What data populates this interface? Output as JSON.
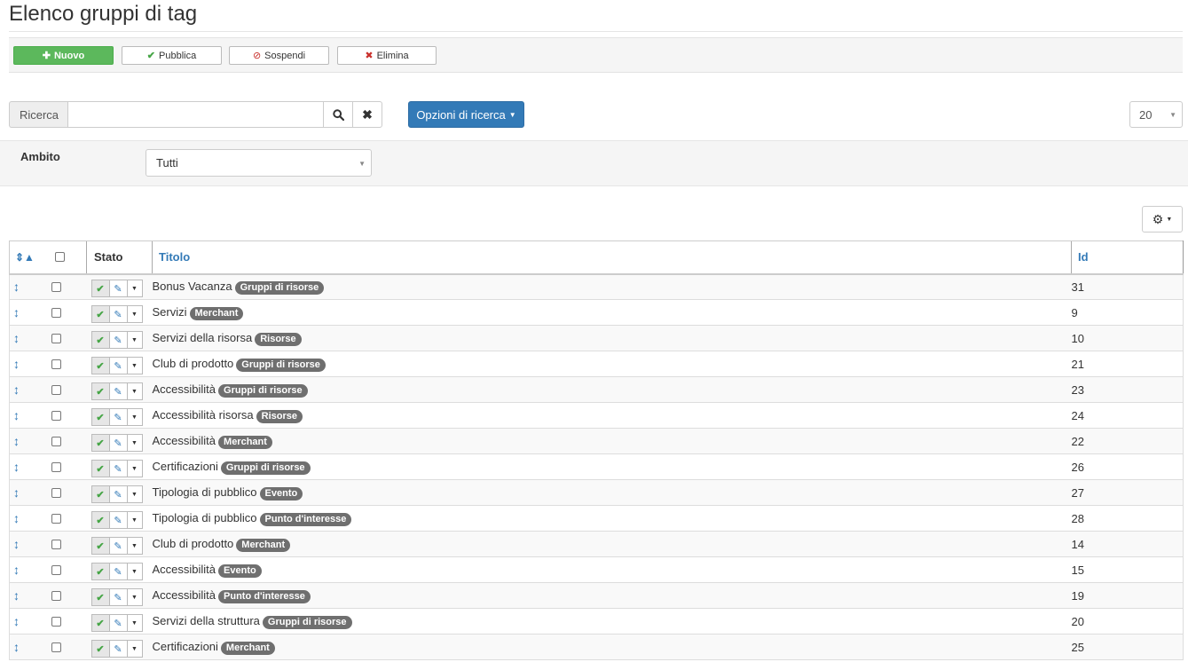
{
  "page": {
    "title": "Elenco gruppi di tag"
  },
  "toolbar": {
    "new_label": "Nuovo",
    "publish_label": "Pubblica",
    "suspend_label": "Sospendi",
    "delete_label": "Elimina"
  },
  "search": {
    "label": "Ricerca",
    "value": "",
    "placeholder": "",
    "options_label": "Opzioni di ricerca",
    "limit_value": "20"
  },
  "filter": {
    "scope_label": "Ambito",
    "scope_value": "Tutti"
  },
  "table": {
    "headers": {
      "stato": "Stato",
      "titolo": "Titolo",
      "id": "Id"
    },
    "rows": [
      {
        "title": "Bonus Vacanza",
        "badge": "Gruppi di risorse",
        "id": "31"
      },
      {
        "title": "Servizi",
        "badge": "Merchant",
        "id": "9"
      },
      {
        "title": "Servizi della risorsa",
        "badge": "Risorse",
        "id": "10"
      },
      {
        "title": "Club di prodotto",
        "badge": "Gruppi di risorse",
        "id": "21"
      },
      {
        "title": "Accessibilità",
        "badge": "Gruppi di risorse",
        "id": "23"
      },
      {
        "title": "Accessibilità risorsa",
        "badge": "Risorse",
        "id": "24"
      },
      {
        "title": "Accessibilità",
        "badge": "Merchant",
        "id": "22"
      },
      {
        "title": "Certificazioni",
        "badge": "Gruppi di risorse",
        "id": "26"
      },
      {
        "title": "Tipologia di pubblico",
        "badge": "Evento",
        "id": "27"
      },
      {
        "title": "Tipologia di pubblico",
        "badge": "Punto d'interesse",
        "id": "28"
      },
      {
        "title": "Club di prodotto",
        "badge": "Merchant",
        "id": "14"
      },
      {
        "title": "Accessibilità",
        "badge": "Evento",
        "id": "15"
      },
      {
        "title": "Accessibilità",
        "badge": "Punto d'interesse",
        "id": "19"
      },
      {
        "title": "Servizi della struttura",
        "badge": "Gruppi di risorse",
        "id": "20"
      },
      {
        "title": "Certificazioni",
        "badge": "Merchant",
        "id": "25"
      }
    ]
  },
  "icons": {
    "new": "plus-icon",
    "publish": "check-icon",
    "suspend": "ban-icon",
    "delete": "x-icon",
    "search": "search-icon",
    "clear": "close-icon",
    "settings": "gear-icon",
    "drag": "drag-handle-icon",
    "edit": "edit-icon"
  },
  "colors": {
    "primary": "#337ab7",
    "success": "#5cb85c",
    "badge": "#6f6f6f",
    "danger": "#c9302c"
  }
}
